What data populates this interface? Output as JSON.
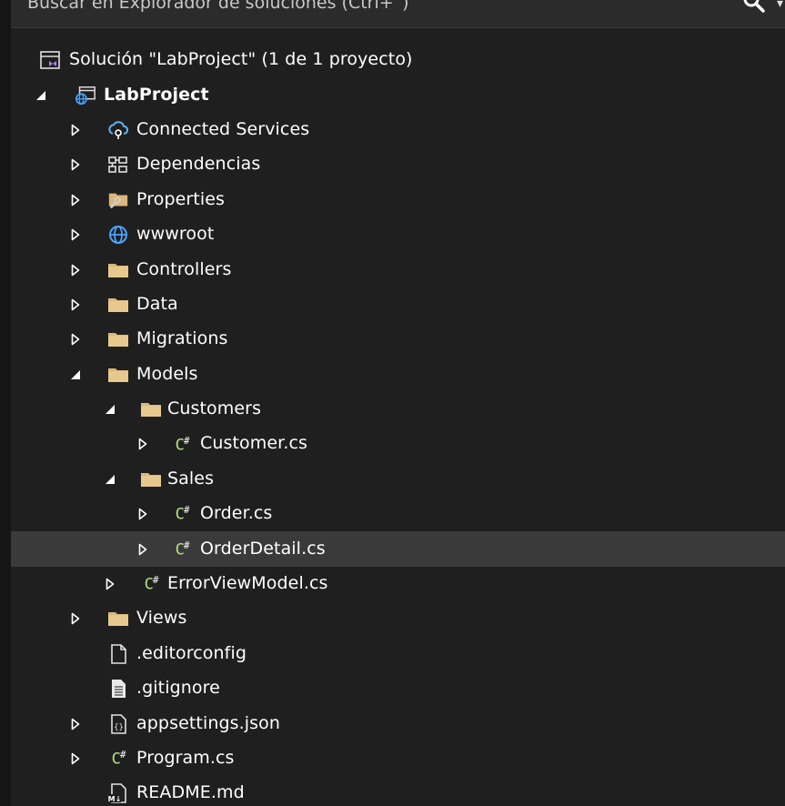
{
  "search": {
    "placeholder": "Buscar en Explorador de soluciones (Ctrl+`)"
  },
  "colors": {
    "background": "#1f1f1f",
    "selection": "#3a3a3a",
    "folder": "#dcb67a",
    "csharp": "#b8e07c",
    "service": "#55aaff"
  },
  "tree": [
    {
      "label": "Solución \"LabProject\"  (1 de 1 proyecto)",
      "icon": "solution-icon",
      "expander": "none",
      "level": 0
    },
    {
      "label": "LabProject",
      "icon": "web-project-icon",
      "expander": "expanded",
      "level": 1,
      "bold": true
    },
    {
      "label": "Connected Services",
      "icon": "connected-services-icon",
      "expander": "collapsed",
      "level": 2
    },
    {
      "label": "Dependencias",
      "icon": "dependencies-icon",
      "expander": "collapsed",
      "level": 2
    },
    {
      "label": "Properties",
      "icon": "properties-icon",
      "expander": "collapsed",
      "level": 2
    },
    {
      "label": "wwwroot",
      "icon": "globe-icon",
      "expander": "collapsed",
      "level": 2
    },
    {
      "label": "Controllers",
      "icon": "folder-icon",
      "expander": "collapsed",
      "level": 2
    },
    {
      "label": "Data",
      "icon": "folder-icon",
      "expander": "collapsed",
      "level": 2
    },
    {
      "label": "Migrations",
      "icon": "folder-icon",
      "expander": "collapsed",
      "level": 2
    },
    {
      "label": "Models",
      "icon": "folder-icon",
      "expander": "expanded",
      "level": 2
    },
    {
      "label": "Customers",
      "icon": "folder-icon",
      "expander": "expanded",
      "level": 3
    },
    {
      "label": "Customer.cs",
      "icon": "csharp-file-icon",
      "expander": "collapsed",
      "level": 4
    },
    {
      "label": "Sales",
      "icon": "folder-icon",
      "expander": "expanded",
      "level": 3
    },
    {
      "label": "Order.cs",
      "icon": "csharp-file-icon",
      "expander": "collapsed",
      "level": 4
    },
    {
      "label": "OrderDetail.cs",
      "icon": "csharp-file-icon",
      "expander": "collapsed",
      "level": 4,
      "selected": true
    },
    {
      "label": "ErrorViewModel.cs",
      "icon": "csharp-file-icon",
      "expander": "collapsed",
      "level": 3
    },
    {
      "label": "Views",
      "icon": "folder-icon",
      "expander": "collapsed",
      "level": 2
    },
    {
      "label": ".editorconfig",
      "icon": "blank-file-icon",
      "expander": "none",
      "level": 2
    },
    {
      "label": ".gitignore",
      "icon": "text-file-icon",
      "expander": "none",
      "level": 2
    },
    {
      "label": "appsettings.json",
      "icon": "json-file-icon",
      "expander": "collapsed",
      "level": 2
    },
    {
      "label": "Program.cs",
      "icon": "csharp-file-icon",
      "expander": "collapsed",
      "level": 2
    },
    {
      "label": "README.md",
      "icon": "markdown-file-icon",
      "expander": "none",
      "level": 2
    }
  ]
}
